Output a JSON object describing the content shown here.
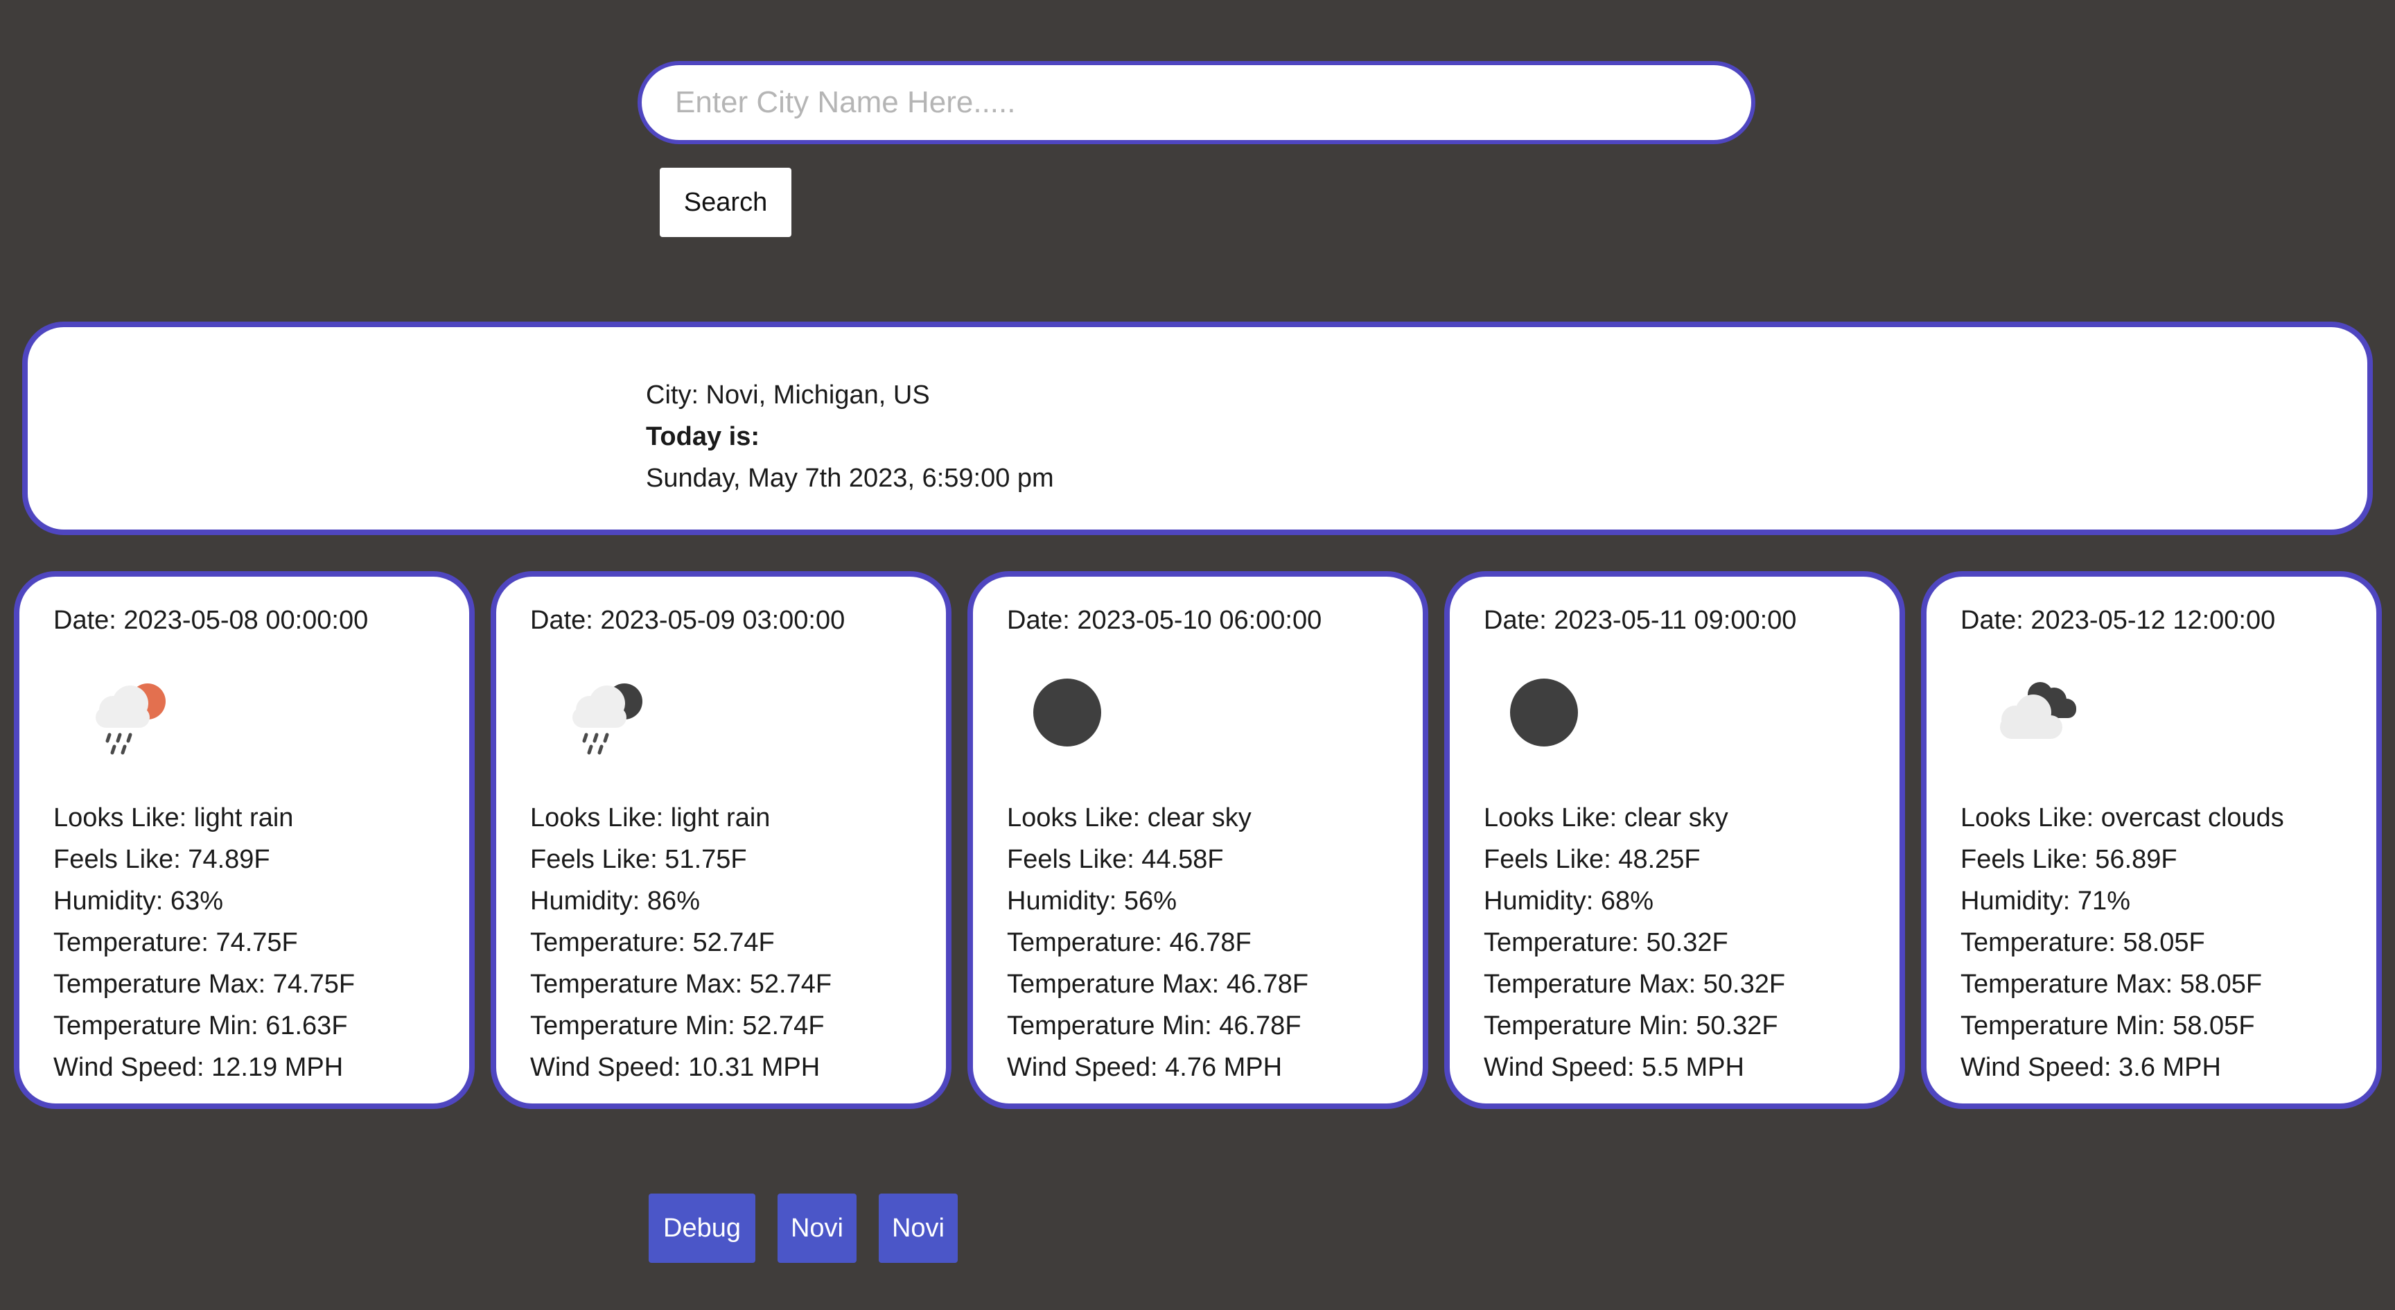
{
  "search": {
    "placeholder": "Enter City Name Here.....",
    "value": "",
    "button_label": "Search"
  },
  "current": {
    "city_line": "City: Novi, Michigan, US",
    "today_label": "Today is:",
    "datetime": "Sunday, May 7th 2023, 6:59:00 pm"
  },
  "forecast": [
    {
      "date": "Date: 2023-05-08 00:00:00",
      "icon": "rain-with-sun-icon",
      "looks_like": "Looks Like: light rain",
      "feels_like": "Feels Like: 74.89F",
      "humidity": "Humidity: 63%",
      "temperature": "Temperature: 74.75F",
      "temp_max": "Temperature Max: 74.75F",
      "temp_min": "Temperature Min: 61.63F",
      "wind_speed": "Wind Speed: 12.19 MPH"
    },
    {
      "date": "Date: 2023-05-09 03:00:00",
      "icon": "rain-with-moon-icon",
      "looks_like": "Looks Like: light rain",
      "feels_like": "Feels Like: 51.75F",
      "humidity": "Humidity: 86%",
      "temperature": "Temperature: 52.74F",
      "temp_max": "Temperature Max: 52.74F",
      "temp_min": "Temperature Min: 52.74F",
      "wind_speed": "Wind Speed: 10.31 MPH"
    },
    {
      "date": "Date: 2023-05-10 06:00:00",
      "icon": "moon-icon",
      "looks_like": "Looks Like: clear sky",
      "feels_like": "Feels Like: 44.58F",
      "humidity": "Humidity: 56%",
      "temperature": "Temperature: 46.78F",
      "temp_max": "Temperature Max: 46.78F",
      "temp_min": "Temperature Min: 46.78F",
      "wind_speed": "Wind Speed: 4.76 MPH"
    },
    {
      "date": "Date: 2023-05-11 09:00:00",
      "icon": "moon-icon",
      "looks_like": "Looks Like: clear sky",
      "feels_like": "Feels Like: 48.25F",
      "humidity": "Humidity: 68%",
      "temperature": "Temperature: 50.32F",
      "temp_max": "Temperature Max: 50.32F",
      "temp_min": "Temperature Min: 50.32F",
      "wind_speed": "Wind Speed: 5.5 MPH"
    },
    {
      "date": "Date: 2023-05-12 12:00:00",
      "icon": "overcast-clouds-icon",
      "looks_like": "Looks Like: overcast clouds",
      "feels_like": "Feels Like: 56.89F",
      "humidity": "Humidity: 71%",
      "temperature": "Temperature: 58.05F",
      "temp_max": "Temperature Max: 58.05F",
      "temp_min": "Temperature Min: 58.05F",
      "wind_speed": "Wind Speed: 3.6 MPH"
    }
  ],
  "footer": {
    "buttons": [
      "Debug",
      "Novi",
      "Novi"
    ]
  },
  "colors": {
    "background": "#403d3b",
    "accent_border": "#4f46c0",
    "button_blue": "#4b56c8",
    "sun_orange": "#e3704f",
    "moon_dark": "#3f3f3f",
    "cloud_light": "#ededed"
  }
}
